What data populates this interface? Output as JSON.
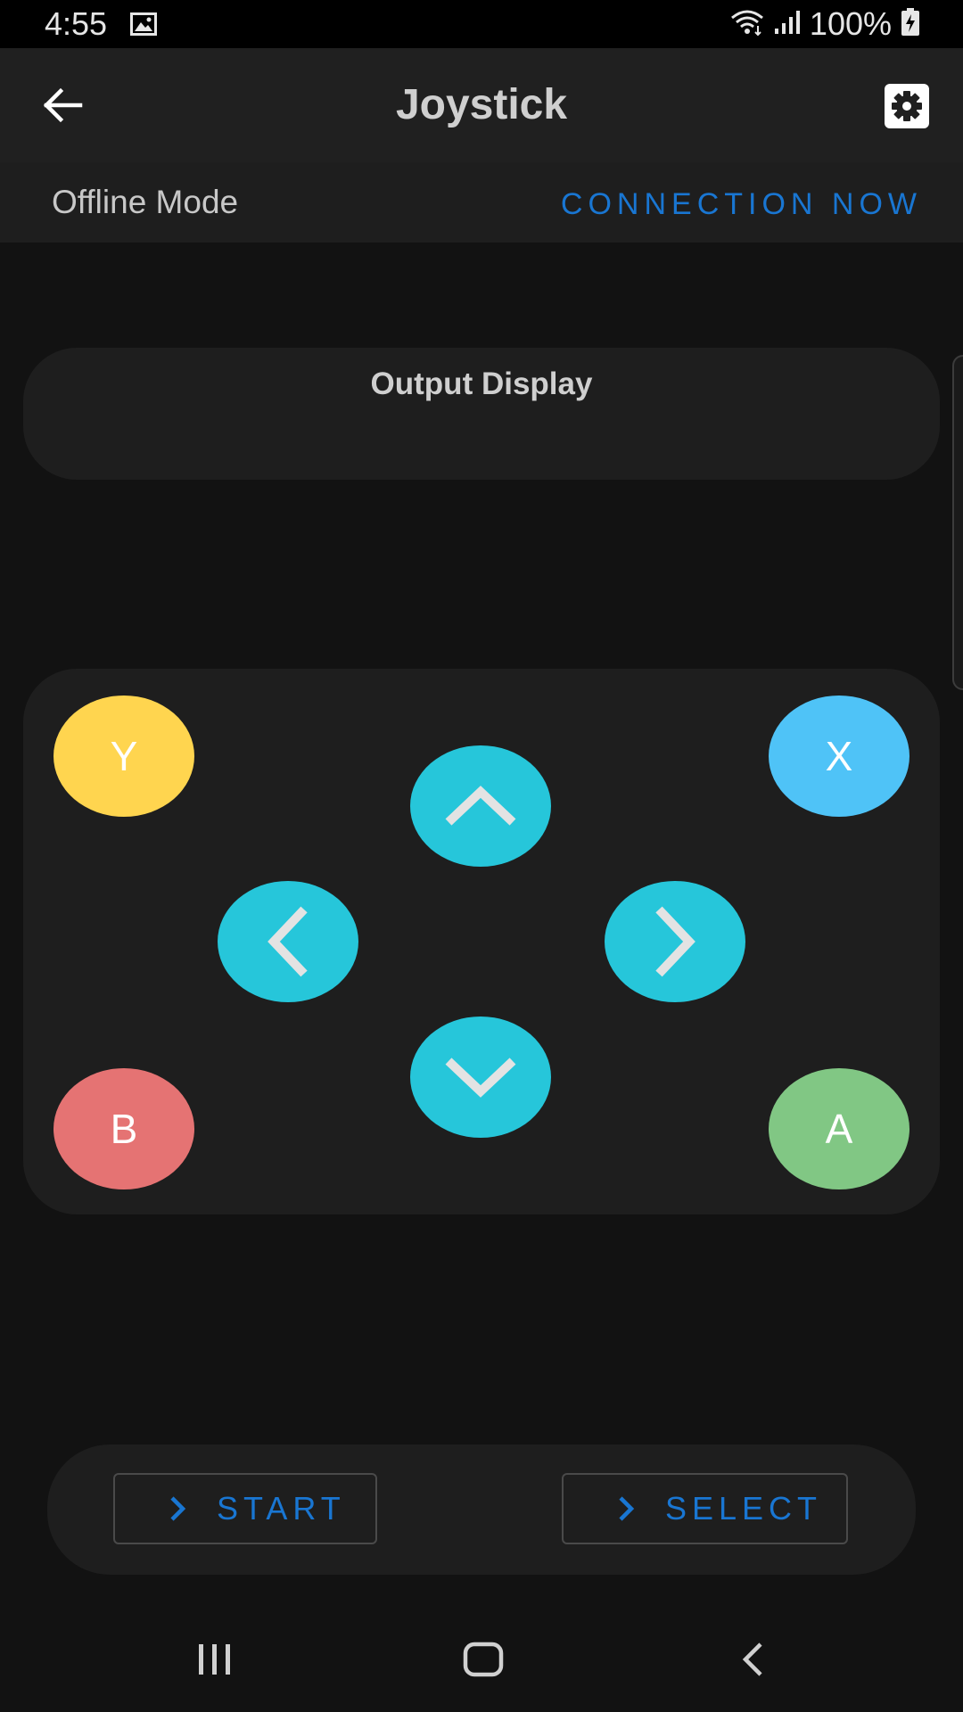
{
  "status_bar": {
    "time": "4:55",
    "battery": "100%",
    "icons": [
      "image-icon",
      "wifi-icon",
      "signal-icon",
      "battery-charging-icon"
    ]
  },
  "app_bar": {
    "title": "Joystick",
    "back_icon": "arrow-left-icon",
    "settings_icon": "gear-icon"
  },
  "connection": {
    "mode": "Offline Mode",
    "action": "CONNECTION NOW",
    "accent": "#1976d2"
  },
  "output": {
    "title": "Output Display"
  },
  "gamepad": {
    "buttons": [
      {
        "label": "Y",
        "color": "#ffd54f"
      },
      {
        "label": "X",
        "color": "#4fc3f7"
      },
      {
        "label": "B",
        "color": "#e57373"
      },
      {
        "label": "A",
        "color": "#81c784"
      }
    ],
    "dpad_color": "#26c6da",
    "dpad_icons": [
      "chevron-up-icon",
      "chevron-left-icon",
      "chevron-right-icon",
      "chevron-down-icon"
    ]
  },
  "controls": {
    "start": "START",
    "select": "SELECT"
  },
  "nav": {
    "icons": [
      "recent-apps-icon",
      "home-icon",
      "back-icon"
    ]
  }
}
